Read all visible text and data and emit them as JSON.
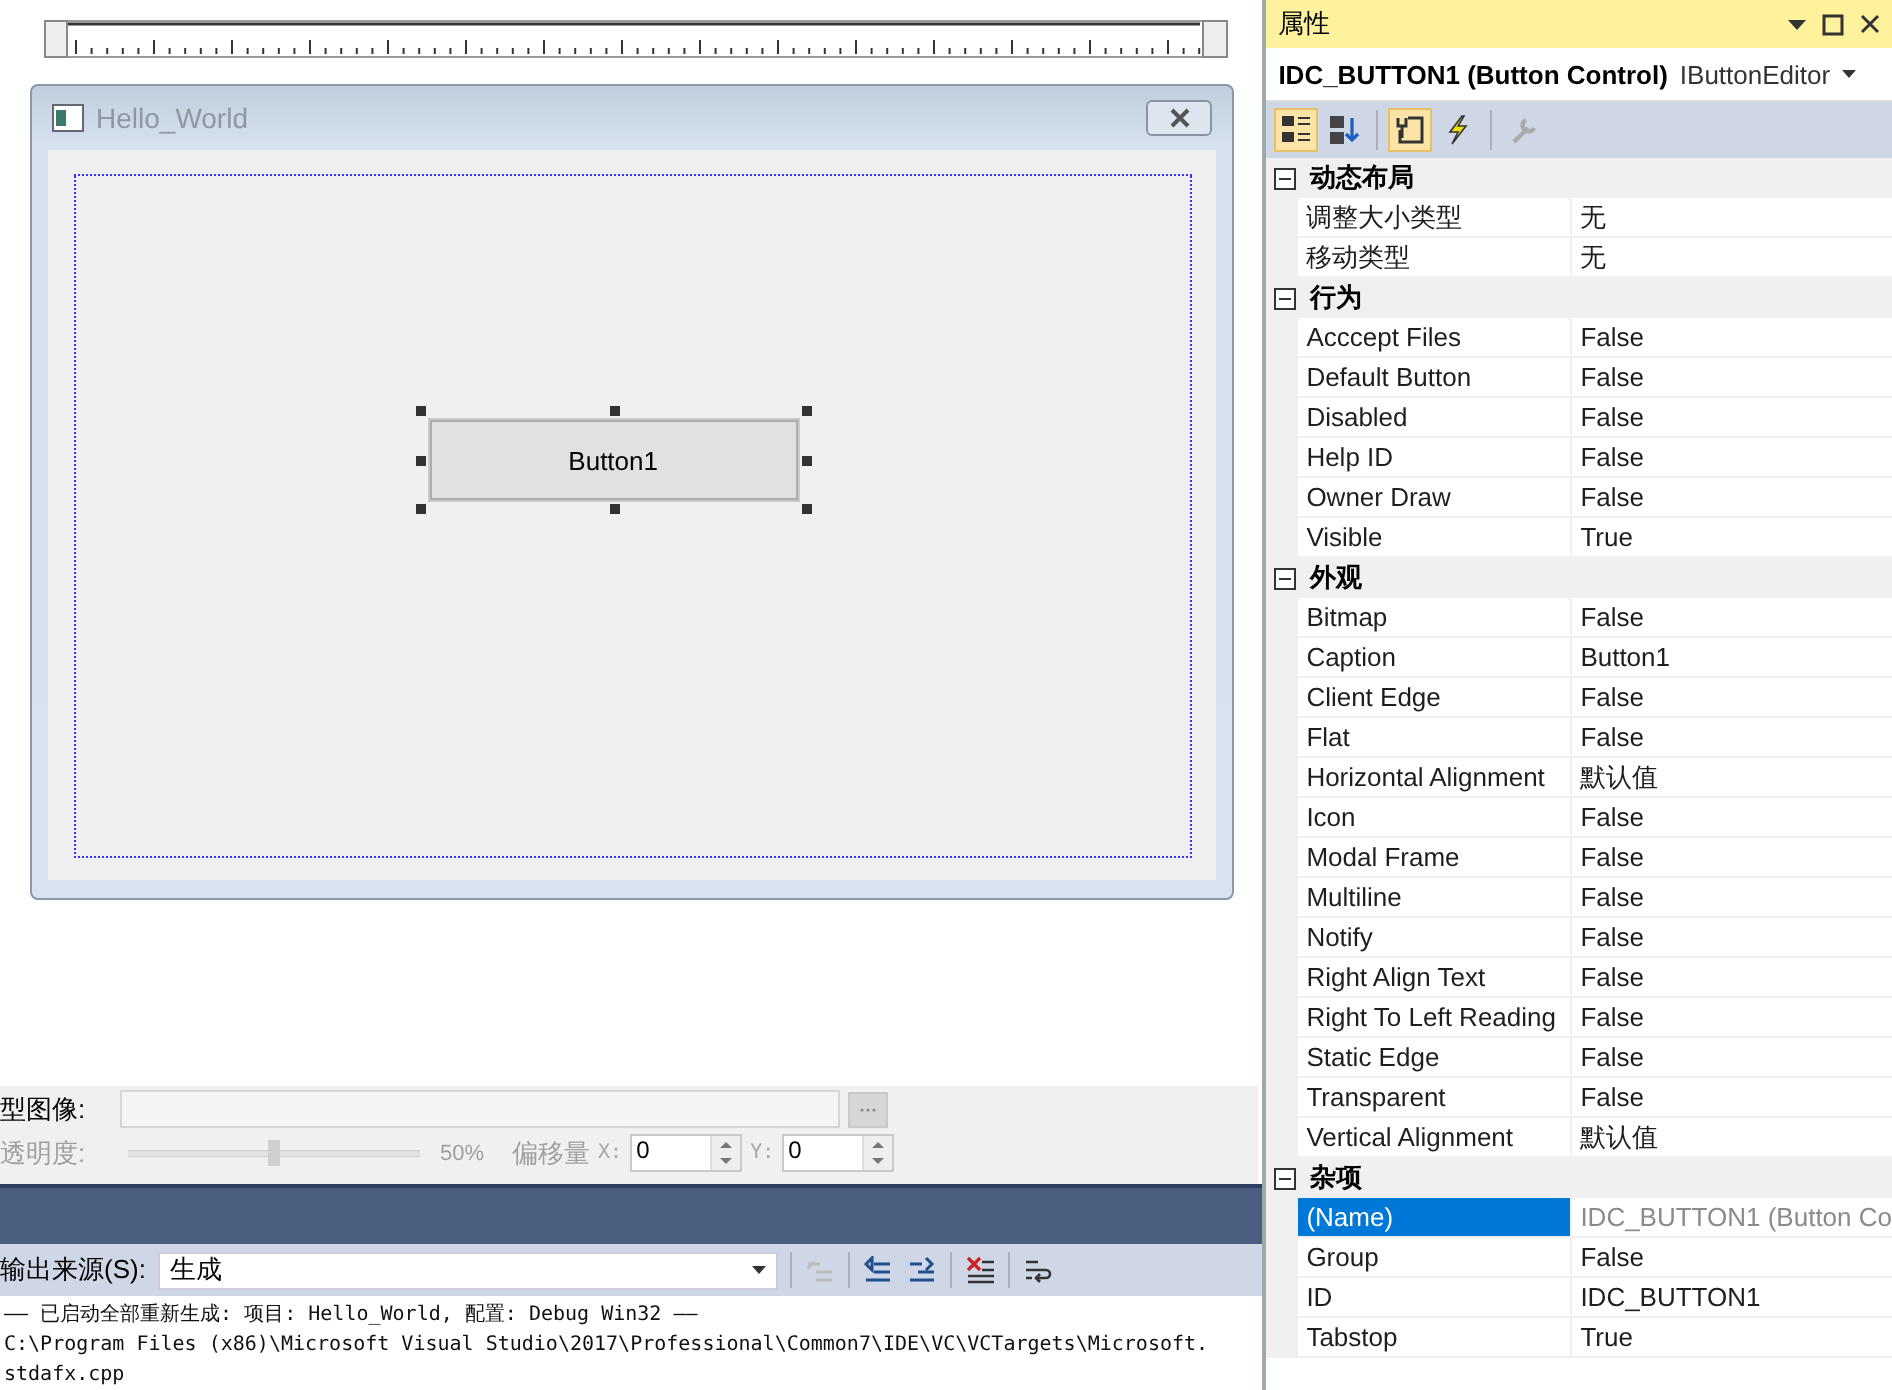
{
  "dialog": {
    "title": "Hello_World",
    "button": {
      "label": "Button1",
      "selected": true
    }
  },
  "prototype": {
    "image_label": "型图像:",
    "opacity_label": "透明度:",
    "opacity": {
      "level": 0.5,
      "reading": "50%",
      "disabled": true
    },
    "offset_label": "偏移量",
    "x_label": "X:",
    "x_value": "0",
    "y_label": "Y:",
    "y_value": "0"
  },
  "output": {
    "source_label": "输出来源(S):",
    "source_value": "生成",
    "lines": [
      "—— 已启动全部重新生成: 项目: Hello_World, 配置: Debug Win32 ——",
      "C:\\Program Files (x86)\\Microsoft Visual Studio\\2017\\Professional\\Common7\\IDE\\VC\\VCTargets\\Microsoft.",
      "stdafx.cpp"
    ]
  },
  "properties": {
    "title": "属性",
    "object_name": "IDC_BUTTON1 (Button Control)",
    "object_type": "IButtonEditor",
    "categories": [
      {
        "label": "动态布局",
        "expanded": true,
        "properties": [
          {
            "name": "调整大小类型",
            "value": "无",
            "selected": false,
            "readonly": false
          },
          {
            "name": "移动类型",
            "value": "无",
            "selected": false,
            "readonly": false
          }
        ]
      },
      {
        "label": "行为",
        "expanded": true,
        "properties": [
          {
            "name": "Acccept Files",
            "value": "False",
            "selected": false,
            "readonly": false
          },
          {
            "name": "Default Button",
            "value": "False",
            "selected": false,
            "readonly": false
          },
          {
            "name": "Disabled",
            "value": "False",
            "selected": false,
            "readonly": false
          },
          {
            "name": "Help ID",
            "value": "False",
            "selected": false,
            "readonly": false
          },
          {
            "name": "Owner Draw",
            "value": "False",
            "selected": false,
            "readonly": false
          },
          {
            "name": "Visible",
            "value": "True",
            "selected": false,
            "readonly": false
          }
        ]
      },
      {
        "label": "外观",
        "expanded": true,
        "properties": [
          {
            "name": "Bitmap",
            "value": "False",
            "selected": false,
            "readonly": false
          },
          {
            "name": "Caption",
            "value": "Button1",
            "selected": false,
            "readonly": false
          },
          {
            "name": "Client Edge",
            "value": "False",
            "selected": false,
            "readonly": false
          },
          {
            "name": "Flat",
            "value": "False",
            "selected": false,
            "readonly": false
          },
          {
            "name": "Horizontal Alignment",
            "value": "默认值",
            "selected": false,
            "readonly": false
          },
          {
            "name": "Icon",
            "value": "False",
            "selected": false,
            "readonly": false
          },
          {
            "name": "Modal Frame",
            "value": "False",
            "selected": false,
            "readonly": false
          },
          {
            "name": "Multiline",
            "value": "False",
            "selected": false,
            "readonly": false
          },
          {
            "name": "Notify",
            "value": "False",
            "selected": false,
            "readonly": false
          },
          {
            "name": "Right Align Text",
            "value": "False",
            "selected": false,
            "readonly": false
          },
          {
            "name": "Right To Left Reading",
            "value": "False",
            "selected": false,
            "readonly": false
          },
          {
            "name": "Static Edge",
            "value": "False",
            "selected": false,
            "readonly": false
          },
          {
            "name": "Transparent",
            "value": "False",
            "selected": false,
            "readonly": false
          },
          {
            "name": "Vertical Alignment",
            "value": "默认值",
            "selected": false,
            "readonly": false
          }
        ]
      },
      {
        "label": "杂项",
        "expanded": true,
        "properties": [
          {
            "name": "(Name)",
            "value": "IDC_BUTTON1 (Button Co",
            "selected": true,
            "readonly": true
          },
          {
            "name": "Group",
            "value": "False",
            "selected": false,
            "readonly": false
          },
          {
            "name": "ID",
            "value": "IDC_BUTTON1",
            "selected": false,
            "readonly": false
          },
          {
            "name": "Tabstop",
            "value": "True",
            "selected": false,
            "readonly": false
          }
        ]
      }
    ]
  }
}
